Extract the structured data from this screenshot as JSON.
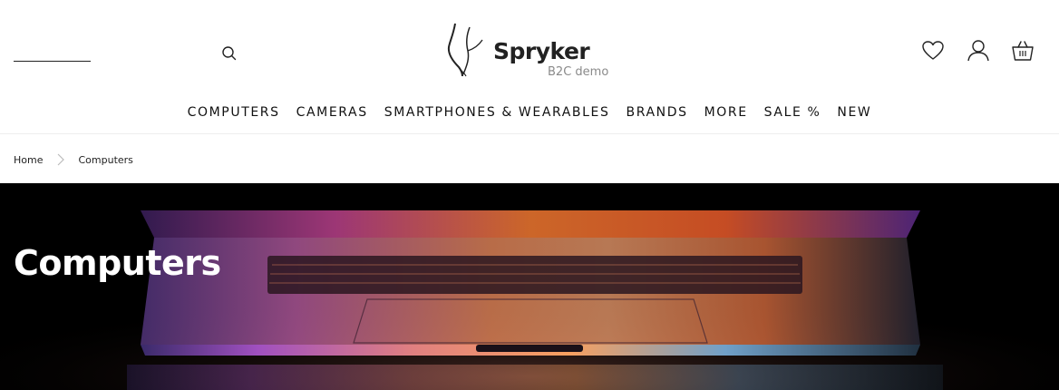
{
  "header": {
    "search": {
      "value": "",
      "placeholder": ""
    },
    "icons": {
      "search": "search-icon",
      "wishlist": "heart-icon",
      "account": "user-icon",
      "cart": "basket-icon"
    }
  },
  "logo": {
    "brand": "Spryker",
    "subtitle": "B2C demo"
  },
  "nav": {
    "items": [
      {
        "label": "COMPUTERS"
      },
      {
        "label": "CAMERAS"
      },
      {
        "label": "SMARTPHONES & WEARABLES"
      },
      {
        "label": "BRANDS"
      },
      {
        "label": "MORE"
      },
      {
        "label": "SALE %"
      },
      {
        "label": "NEW"
      }
    ]
  },
  "breadcrumb": {
    "items": [
      "Home",
      "Computers"
    ]
  },
  "hero": {
    "title": "Computers"
  },
  "colors": {
    "text": "#111111",
    "logo_sub": "#8a8a8a",
    "hero_bg": "#000000"
  }
}
